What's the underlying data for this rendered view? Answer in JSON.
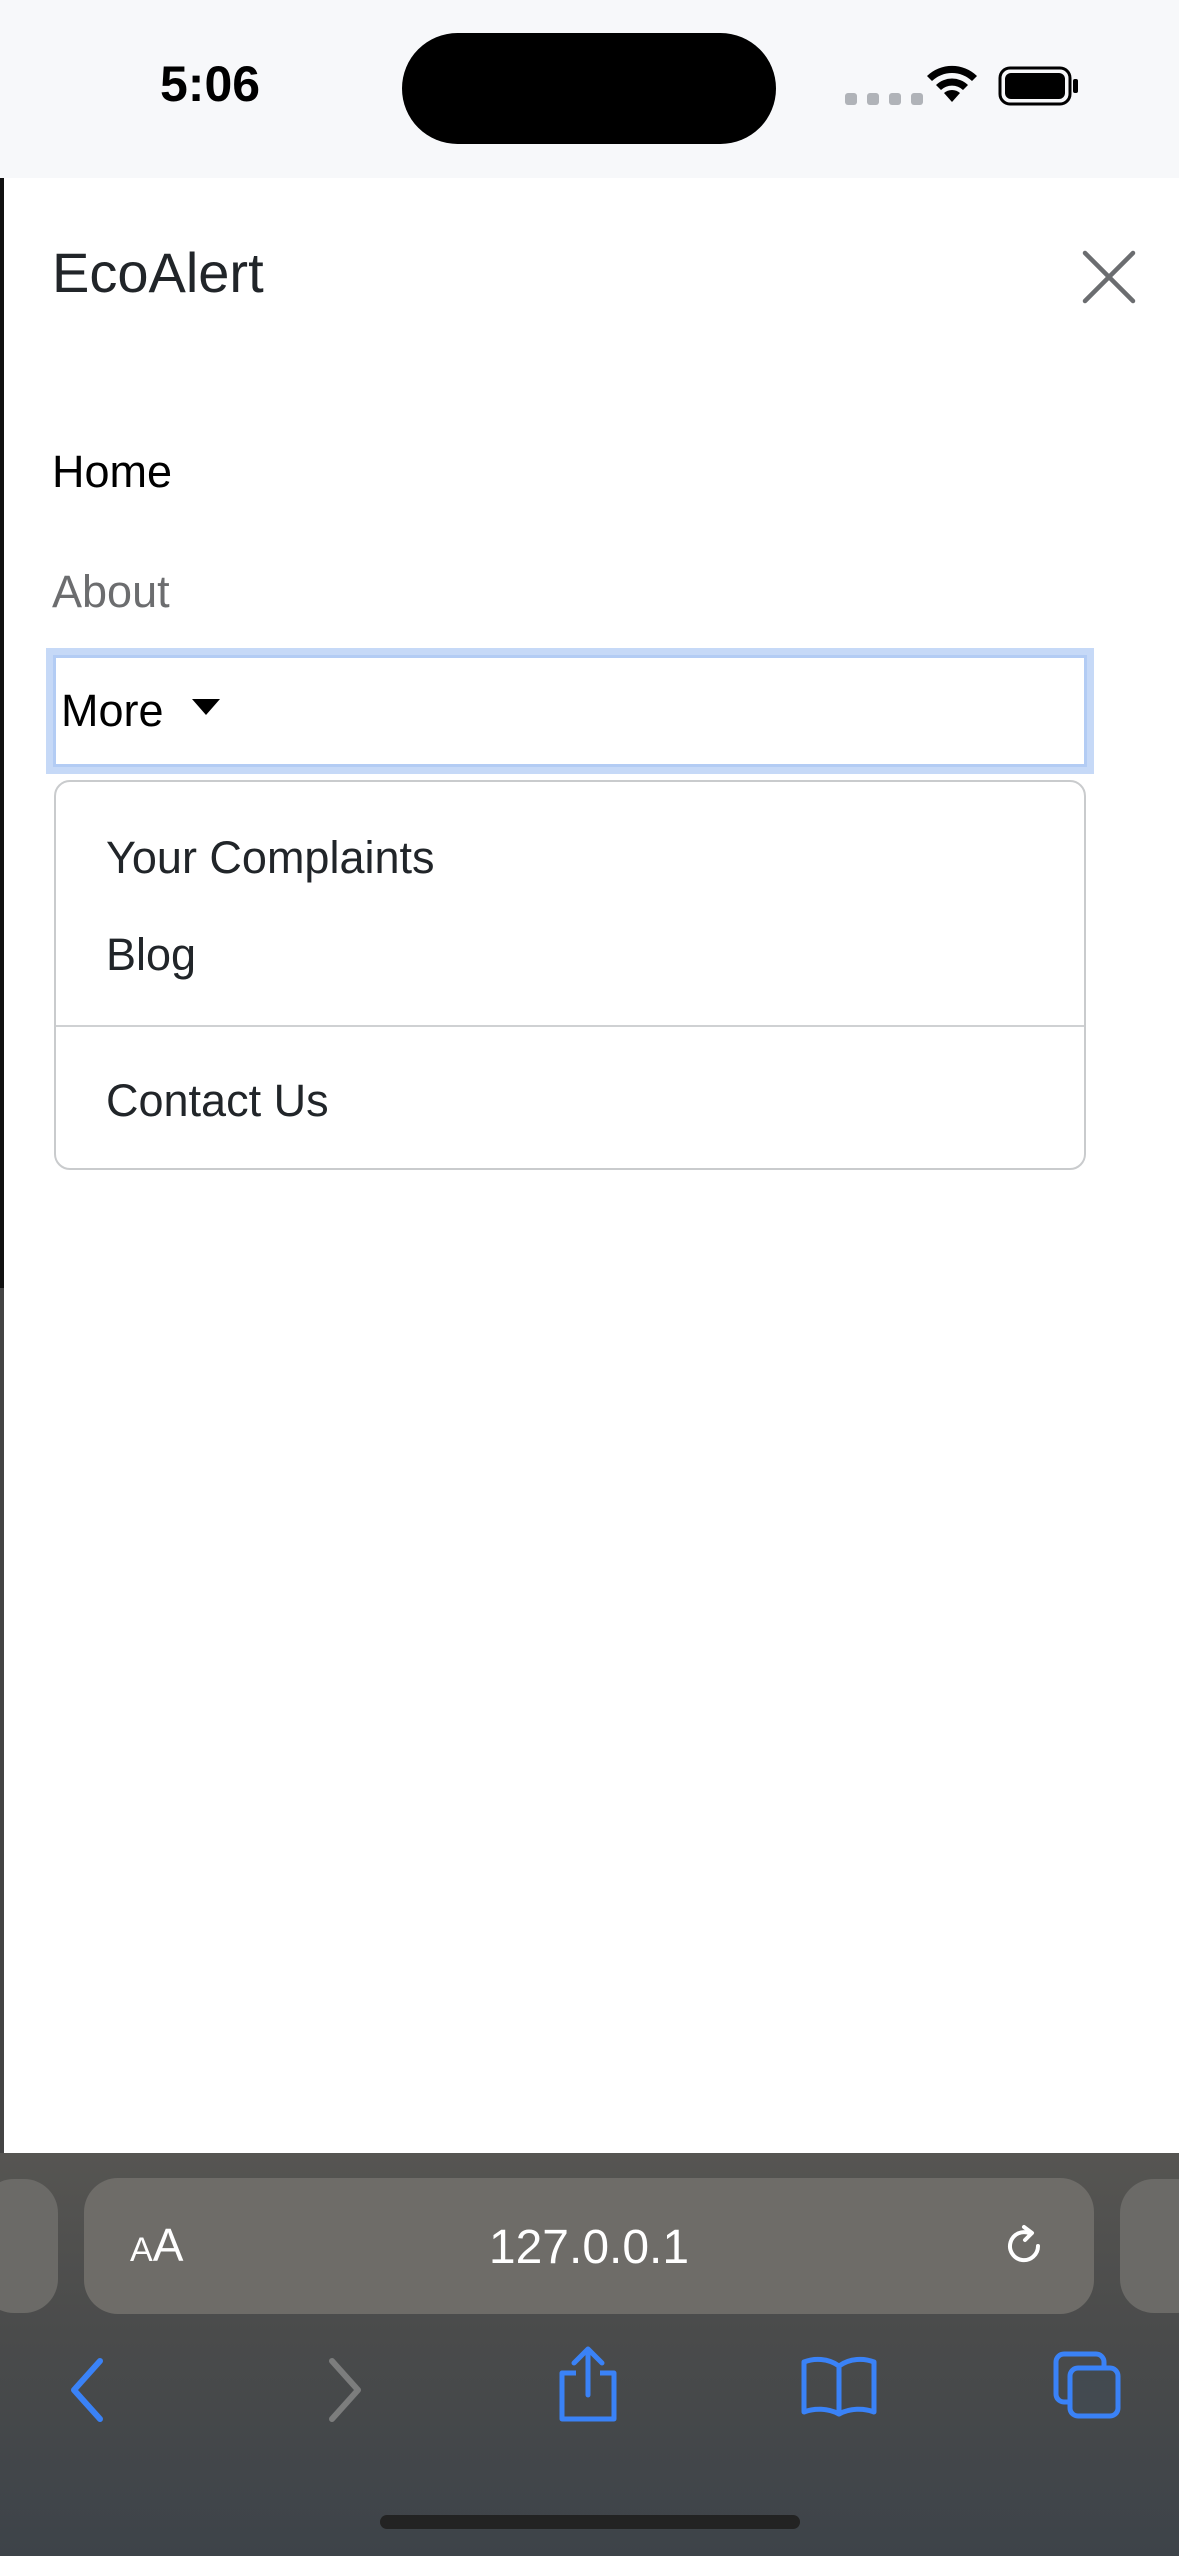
{
  "status_bar": {
    "time": "5:06"
  },
  "offcanvas": {
    "brand": "EcoAlert",
    "nav": {
      "home": "Home",
      "about": "About",
      "more": "More"
    },
    "dropdown": {
      "items": [
        "Your Complaints",
        "Blog",
        "Contact Us"
      ]
    }
  },
  "safari": {
    "text_size_label_small": "A",
    "text_size_label_big": "A",
    "url": "127.0.0.1",
    "accent_color": "#3a82f7"
  },
  "icons": {
    "close": "close-icon",
    "back": "chevron-left-icon",
    "forward": "chevron-right-icon",
    "share": "share-icon",
    "bookmarks": "book-icon",
    "tabs": "tabs-icon",
    "reload": "reload-icon",
    "wifi": "wifi-icon",
    "battery": "battery-icon"
  }
}
